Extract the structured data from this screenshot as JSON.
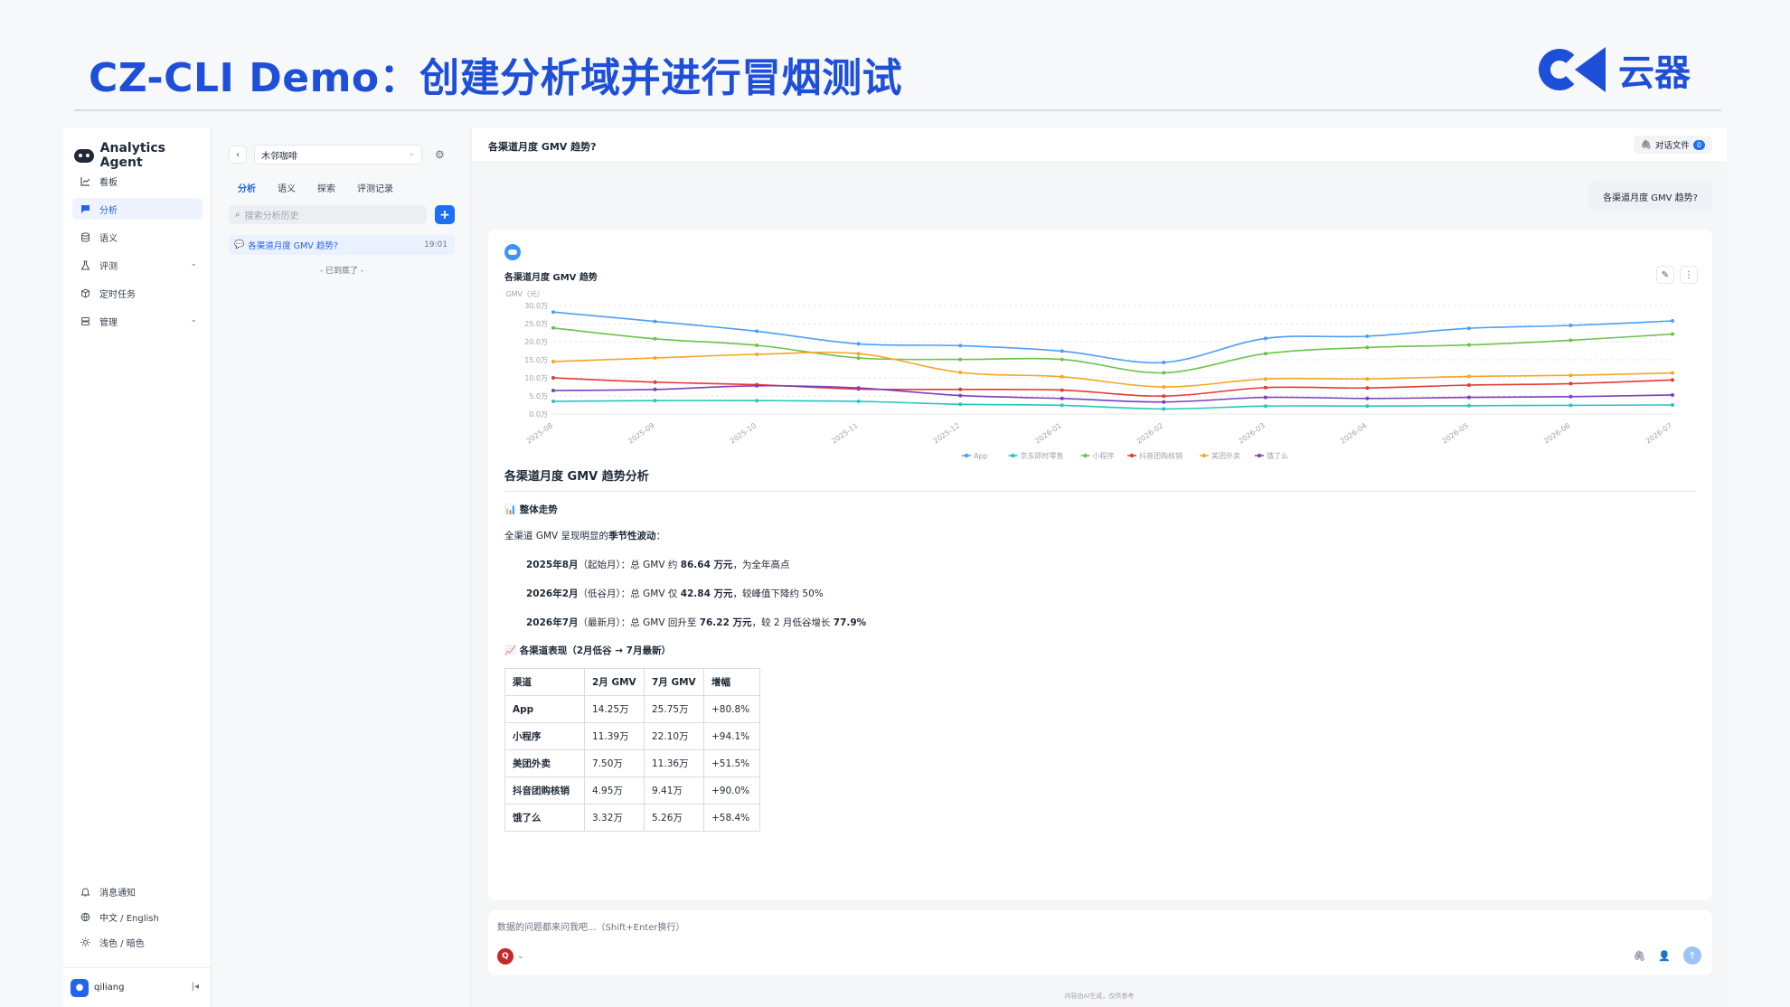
{
  "slide": {
    "title": "CZ-CLI Demo：创建分析域并进行冒烟测试",
    "brand": "云器"
  },
  "nav": {
    "app_name": "Analytics Agent",
    "items": [
      {
        "label": "看板",
        "icon": "chart-icon"
      },
      {
        "label": "分析",
        "icon": "chat-icon"
      },
      {
        "label": "语义",
        "icon": "database-icon"
      },
      {
        "label": "评测",
        "icon": "flask-icon"
      },
      {
        "label": "定时任务",
        "icon": "cube-icon"
      },
      {
        "label": "管理",
        "icon": "server-icon"
      }
    ],
    "bottom": [
      {
        "label": "消息通知",
        "icon": "bell-icon"
      },
      {
        "label": "中文 / English",
        "icon": "globe-icon"
      },
      {
        "label": "浅色 / 暗色",
        "icon": "sun-icon"
      }
    ],
    "user": "qiliang"
  },
  "history": {
    "workspace": "木邻咖啡",
    "tabs": [
      "分析",
      "语义",
      "探索",
      "评测记录"
    ],
    "search_placeholder": "搜索分析历史",
    "items": [
      {
        "title": "各渠道月度 GMV 趋势?",
        "time": "19:01"
      }
    ],
    "end_text": "- 已到底了 -"
  },
  "main": {
    "title": "各渠道月度 GMV 趋势?",
    "files_label": "对话文件",
    "files_count": "0",
    "user_question": "各渠道月度 GMV 趋势?",
    "chart_title": "各渠道月度 GMV 趋势",
    "analysis": {
      "heading": "各渠道月度 GMV 趋势分析",
      "overall_title": "📊 整体走势",
      "intro_pre": "全渠道 GMV 呈现明显的",
      "intro_bold": "季节性波动",
      "intro_post": "：",
      "points": [
        {
          "date": "2025年8月",
          "tag": "（起始月）：总 GMV 约 ",
          "value": "86.64 万元",
          "tail": "，为全年高点",
          "extra": ""
        },
        {
          "date": "2026年2月",
          "tag": "（低谷月）：总 GMV 仅 ",
          "value": "42.84 万元",
          "tail": "，较峰值下降约 50%",
          "extra": ""
        },
        {
          "date": "2026年7月",
          "tag": "（最新月）：总 GMV 回升至 ",
          "value": "76.22 万元",
          "tail": "，较 2 月低谷增长 ",
          "extra": "77.9%"
        }
      ],
      "channel_title": "📈 各渠道表现（2月低谷 → 7月最新）",
      "table": {
        "headers": [
          "渠道",
          "2月 GMV",
          "7月 GMV",
          "增幅"
        ],
        "rows": [
          [
            "App",
            "14.25万",
            "25.75万",
            "+80.8%"
          ],
          [
            "小程序",
            "11.39万",
            "22.10万",
            "+94.1%"
          ],
          [
            "美团外卖",
            "7.50万",
            "11.36万",
            "+51.5%"
          ],
          [
            "抖音团购核销",
            "4.95万",
            "9.41万",
            "+90.0%"
          ],
          [
            "饿了么",
            "3.32万",
            "5.26万",
            "+58.4%"
          ]
        ]
      }
    },
    "composer_placeholder": "数据的问题都来问我吧...（Shift+Enter换行）",
    "model_letter": "Q",
    "footnote": "内容由AI生成，仅供参考"
  },
  "chart_data": {
    "type": "line",
    "title": "各渠道月度 GMV 趋势",
    "ylabel": "GMV（元）",
    "x": [
      "2025-08",
      "2025-09",
      "2025-10",
      "2025-11",
      "2025-12",
      "2026-01",
      "2026-02",
      "2026-03",
      "2026-04",
      "2026-05",
      "2026-06",
      "2026-07"
    ],
    "y_ticks": [
      "0.0万",
      "5.0万",
      "10.0万",
      "15.0万",
      "20.0万",
      "25.0万",
      "30.0万"
    ],
    "ylim": [
      0,
      300000
    ],
    "grid": true,
    "legend": "bottom",
    "series": [
      {
        "name": "App",
        "color": "#4a9ff5",
        "values": [
          282000,
          256000,
          229000,
          194000,
          189000,
          174000,
          142500,
          209000,
          215000,
          237000,
          245000,
          257500
        ]
      },
      {
        "name": "京东即时零售",
        "color": "#26c6b8",
        "values": [
          35000,
          37000,
          37000,
          35000,
          27000,
          24000,
          14000,
          22000,
          22000,
          23000,
          24000,
          25000
        ]
      },
      {
        "name": "小程序",
        "color": "#6cc24a",
        "values": [
          238000,
          208000,
          190000,
          155000,
          151000,
          151000,
          113900,
          167000,
          184000,
          191000,
          204000,
          221000
        ]
      },
      {
        "name": "抖音团购核销",
        "color": "#e53935",
        "values": [
          100000,
          88000,
          81000,
          69000,
          68000,
          66000,
          49500,
          73000,
          72000,
          80000,
          84000,
          94100
        ]
      },
      {
        "name": "美团外卖",
        "color": "#f5a623",
        "values": [
          145000,
          155000,
          165000,
          167000,
          115000,
          103000,
          75000,
          97000,
          97000,
          104000,
          107000,
          113600
        ]
      },
      {
        "name": "饿了么",
        "color": "#7b3fbf",
        "values": [
          65000,
          68000,
          78000,
          72000,
          51000,
          43000,
          33200,
          46000,
          43000,
          46000,
          48000,
          52600
        ]
      }
    ]
  }
}
